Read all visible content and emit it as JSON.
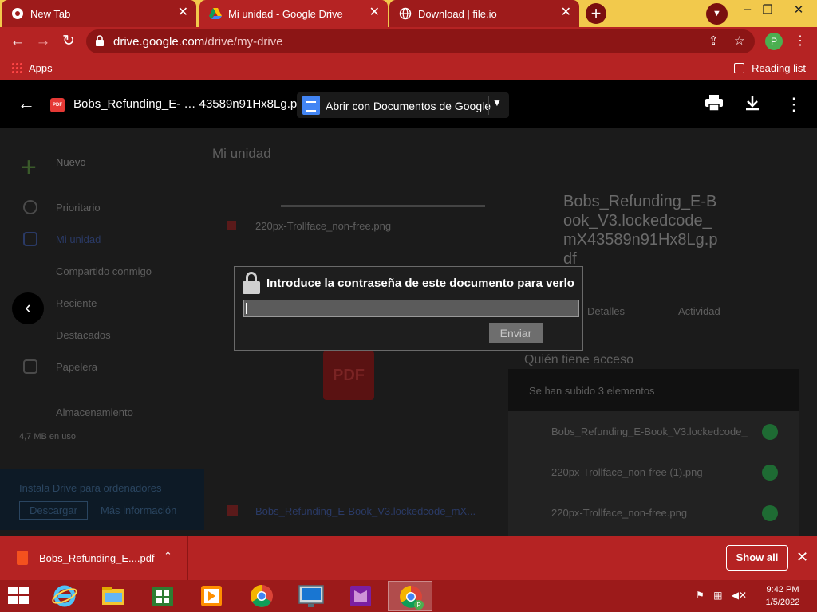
{
  "browser": {
    "tabs": [
      {
        "title": "New Tab",
        "icon": "chrome-icon"
      },
      {
        "title": "Mi unidad - Google Drive",
        "icon": "google-drive-icon",
        "active": true
      },
      {
        "title": "Download | file.io",
        "icon": "globe-icon"
      }
    ],
    "url_host": "drive.google.com",
    "url_path": "/drive/my-drive",
    "profile_initial": "P",
    "bookmarks": {
      "apps": "Apps",
      "reading_list": "Reading list"
    }
  },
  "viewer": {
    "file_title": "Bobs_Refunding_E- … 43589n91Hx8Lg.pdf",
    "open_with": "Abrir con Documentos de Google"
  },
  "drive_background": {
    "new_button": "Nuevo",
    "folder_title": "Mi unidad",
    "nav": [
      "Prioritario",
      "Mi unidad",
      "Compartido conmigo",
      "Reciente",
      "Destacados",
      "Papelera",
      "Almacenamiento"
    ],
    "storage_used": "4,7 MB en uso",
    "install_title": "Instala Drive para ordenadores",
    "install_download": "Descargar",
    "install_more": "Más información",
    "file_rows": [
      "220px-Trollface_non-free.png",
      "Bobs_Refunding_E-Book_V3.lockedcode_mX..."
    ],
    "details_title": "Bobs_Refunding_E-Book_V3.lockedcode_mX43589n91Hx8Lg.pdf",
    "details_tab_1": "Detalles",
    "details_tab_2": "Actividad",
    "who_access": "Quién tiene acceso",
    "upload_panel": {
      "header": "Se han subido 3 elementos",
      "items": [
        "Bobs_Refunding_E-Book_V3.lockedcode_",
        "220px-Trollface_non-free (1).png",
        "220px-Trollface_non-free.png"
      ]
    }
  },
  "password_dialog": {
    "title": "Introduce la contraseña de este documento para verlo",
    "input_value": "",
    "submit_label": "Enviar"
  },
  "downloads_bar": {
    "file_name": "Bobs_Refunding_E....pdf",
    "show_all": "Show all"
  },
  "taskbar": {
    "time": "9:42 PM",
    "date": "1/5/2022"
  }
}
